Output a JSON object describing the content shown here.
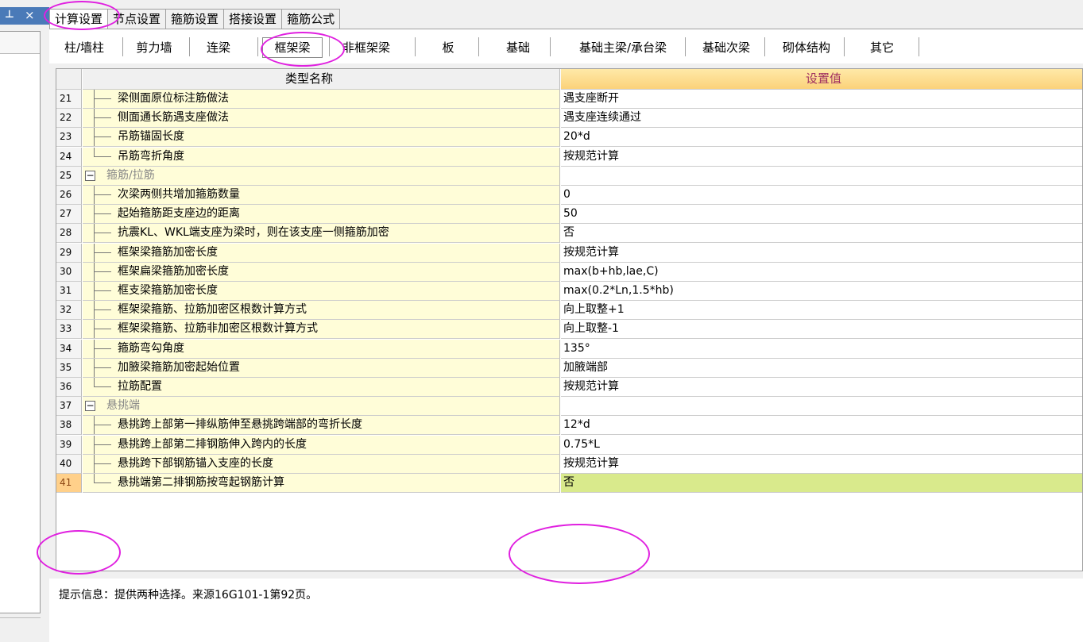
{
  "panel": {
    "pin_glyph": "⊥",
    "close_glyph": "×"
  },
  "top_tabs": [
    {
      "label": "计算设置",
      "active": true
    },
    {
      "label": "节点设置",
      "active": false
    },
    {
      "label": "箍筋设置",
      "active": false
    },
    {
      "label": "搭接设置",
      "active": false
    },
    {
      "label": "箍筋公式",
      "active": false
    }
  ],
  "sub_tabs": [
    {
      "label": "柱/墙柱"
    },
    {
      "label": "剪力墙"
    },
    {
      "label": "连梁"
    },
    {
      "label": "框架梁",
      "active": true
    },
    {
      "label": "非框架梁"
    },
    {
      "label": "板"
    },
    {
      "label": "基础"
    },
    {
      "label": "基础主梁/承台梁"
    },
    {
      "label": "基础次梁"
    },
    {
      "label": "砌体结构"
    },
    {
      "label": "其它"
    }
  ],
  "grid": {
    "header_name": "类型名称",
    "header_value": "设置值",
    "rows": [
      {
        "num": "21",
        "name": "梁侧面原位标注筋做法",
        "value": "遇支座断开"
      },
      {
        "num": "22",
        "name": "侧面通长筋遇支座做法",
        "value": "遇支座连续通过"
      },
      {
        "num": "23",
        "name": "吊筋锚固长度",
        "value": "20*d"
      },
      {
        "num": "24",
        "name": "吊筋弯折角度",
        "value": "按规范计算"
      },
      {
        "num": "25",
        "name": "箍筋/拉筋",
        "value": "",
        "group": true
      },
      {
        "num": "26",
        "name": "次梁两侧共增加箍筋数量",
        "value": "0"
      },
      {
        "num": "27",
        "name": "起始箍筋距支座边的距离",
        "value": "50"
      },
      {
        "num": "28",
        "name": "抗震KL、WKL端支座为梁时，则在该支座一侧箍筋加密",
        "value": "否"
      },
      {
        "num": "29",
        "name": "框架梁箍筋加密长度",
        "value": "按规范计算"
      },
      {
        "num": "30",
        "name": "框架扁梁箍筋加密长度",
        "value": "max(b+hb,lae,C)"
      },
      {
        "num": "31",
        "name": "框支梁箍筋加密长度",
        "value": "max(0.2*Ln,1.5*hb)"
      },
      {
        "num": "32",
        "name": "框架梁箍筋、拉筋加密区根数计算方式",
        "value": "向上取整+1"
      },
      {
        "num": "33",
        "name": "框架梁箍筋、拉筋非加密区根数计算方式",
        "value": "向上取整-1"
      },
      {
        "num": "34",
        "name": "箍筋弯勾角度",
        "value": "135°"
      },
      {
        "num": "35",
        "name": "加腋梁箍筋加密起始位置",
        "value": "加腋端部"
      },
      {
        "num": "36",
        "name": "拉筋配置",
        "value": "按规范计算"
      },
      {
        "num": "37",
        "name": "悬挑端",
        "value": "",
        "group": true
      },
      {
        "num": "38",
        "name": "悬挑跨上部第一排纵筋伸至悬挑跨端部的弯折长度",
        "value": "12*d"
      },
      {
        "num": "39",
        "name": "悬挑跨上部第二排钢筋伸入跨内的长度",
        "value": "0.75*L"
      },
      {
        "num": "40",
        "name": "悬挑跨下部钢筋锚入支座的长度",
        "value": "按规范计算"
      },
      {
        "num": "41",
        "name": "悬挑端第二排钢筋按弯起钢筋计算",
        "value": "否",
        "selected": true
      }
    ]
  },
  "hint": "提示信息：提供两种选择。来源16G101-1第92页。",
  "colors": {
    "annotation": "#e020e0",
    "selected_value_bg": "#d9ea8c",
    "name_bg": "#fffdd8"
  }
}
